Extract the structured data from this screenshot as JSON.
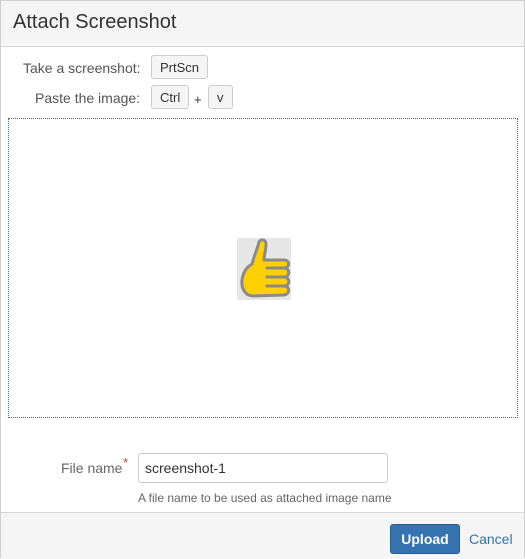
{
  "dialog": {
    "title": "Attach Screenshot"
  },
  "instructions": {
    "take_label": "Take a screenshot:",
    "take_key": "PrtScn",
    "paste_label": "Paste the image:",
    "paste_keys": [
      "Ctrl",
      "v"
    ],
    "plus": "+"
  },
  "paste_area": {
    "image_icon": "thumbs-up-icon",
    "accent_color": "#3572b0",
    "thumb_fill": "#ffd000",
    "thumb_outline": "#8a8a8a"
  },
  "form": {
    "file_name_label": "File name",
    "required_mark": "*",
    "file_name_value": "screenshot-1",
    "help_text": "A file name to be used as attached image name"
  },
  "footer": {
    "upload_label": "Upload",
    "cancel_label": "Cancel"
  }
}
